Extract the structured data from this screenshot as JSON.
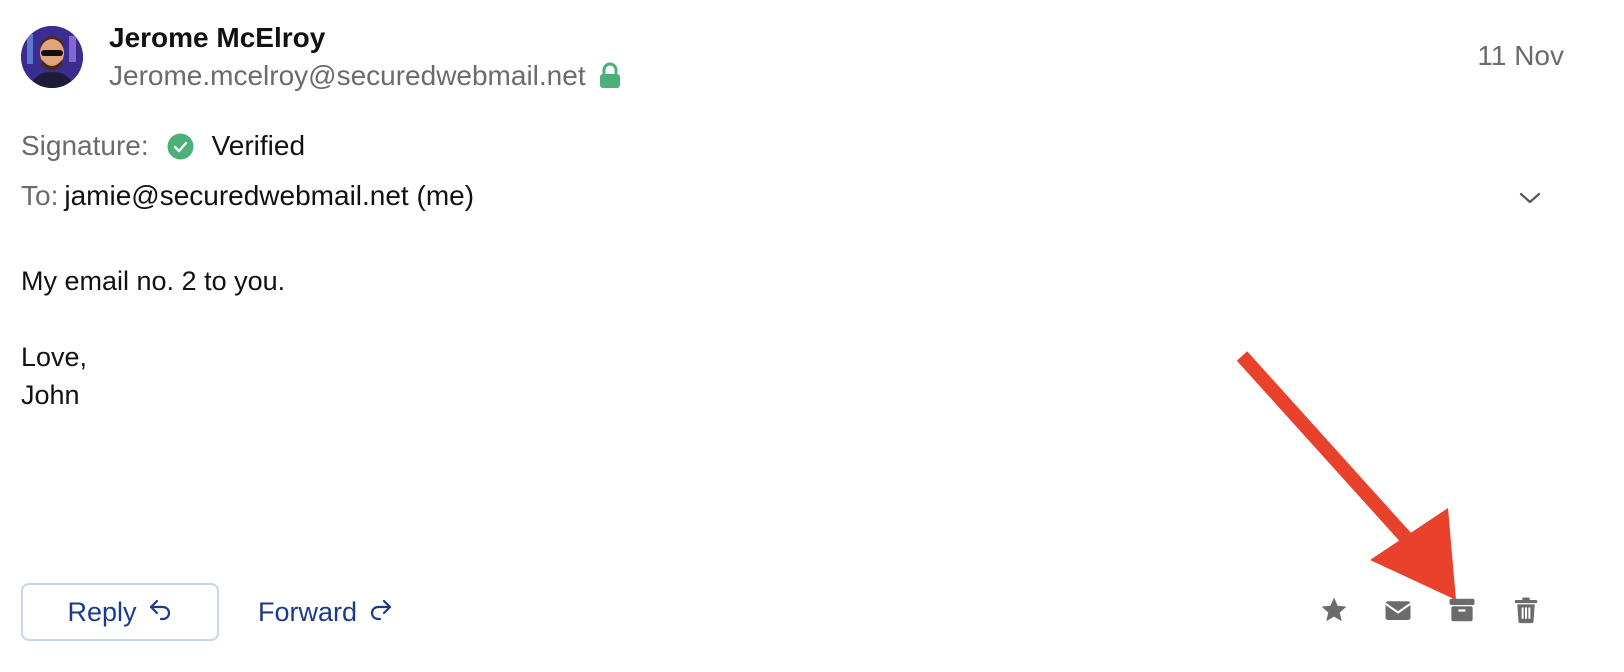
{
  "sender": {
    "name": "Jerome McElroy",
    "email": "Jerome.mcelroy@securedwebmail.net"
  },
  "date": "11 Nov",
  "signature": {
    "label": "Signature:",
    "status": "Verified"
  },
  "recipient": {
    "label": "To:",
    "value": "jamie@securedwebmail.net (me)"
  },
  "message": {
    "line1": "My email no. 2 to you.",
    "line2": "Love,",
    "line3": "John"
  },
  "actions": {
    "reply_label": "Reply",
    "forward_label": "Forward",
    "icons": [
      "star-icon",
      "mail-icon",
      "archive-icon",
      "trash-icon"
    ]
  },
  "colors": {
    "lock": "#4cb07a",
    "verified": "#4cb07a",
    "link": "#1d3a8a",
    "reply_border": "#c5d6f2",
    "icon_gray": "#6b6b6b",
    "annotation_arrow": "#e8412c"
  }
}
